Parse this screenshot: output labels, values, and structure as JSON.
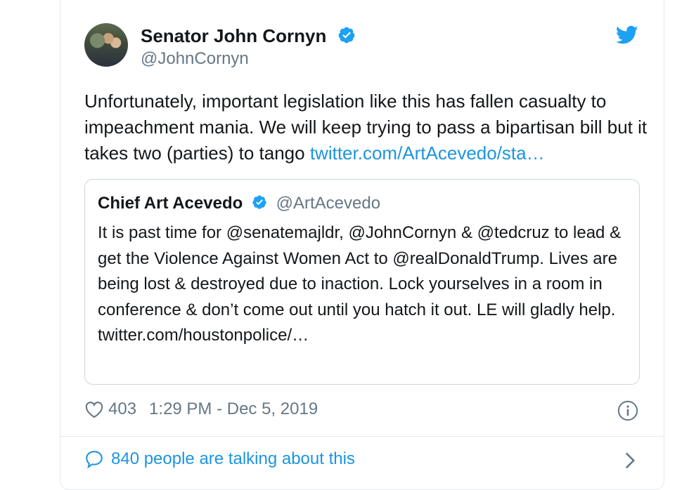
{
  "tweet": {
    "author_name": "Senator John Cornyn",
    "author_handle": "@JohnCornyn",
    "text_before_link": "Unfortunately, important legislation like this has fallen casualty to impeachment mania.  We will keep trying to pass a bipartisan bill but it takes two (parties) to tango ",
    "link_text": "twitter.com/ArtAcevedo/sta…",
    "likes": "403",
    "timestamp": "1:29 PM - Dec 5, 2019",
    "talking": "840 people are talking about this"
  },
  "quoted": {
    "author_name": "Chief Art Acevedo",
    "author_handle": "@ArtAcevedo",
    "text": "It is past time for @senatemajldr, @JohnCornyn & @tedcruz to lead & get the Violence Against Women Act to @realDonaldTrump. Lives are being lost & destroyed due to inaction. Lock yourselves in a room in conference & don’t come out until you hatch it out. LE will gladly help. twitter.com/houstonpolice/…"
  },
  "icons": {
    "verified": "verified-badge-icon",
    "brand": "twitter-bird-icon",
    "like": "heart-icon",
    "info": "info-icon",
    "reply": "speech-bubble-icon",
    "chevron": "chevron-right-icon"
  },
  "colors": {
    "accent": "#1b95e0",
    "verified": "#1da1f2",
    "secondary_text": "#657786",
    "border": "#e1e8ed"
  }
}
